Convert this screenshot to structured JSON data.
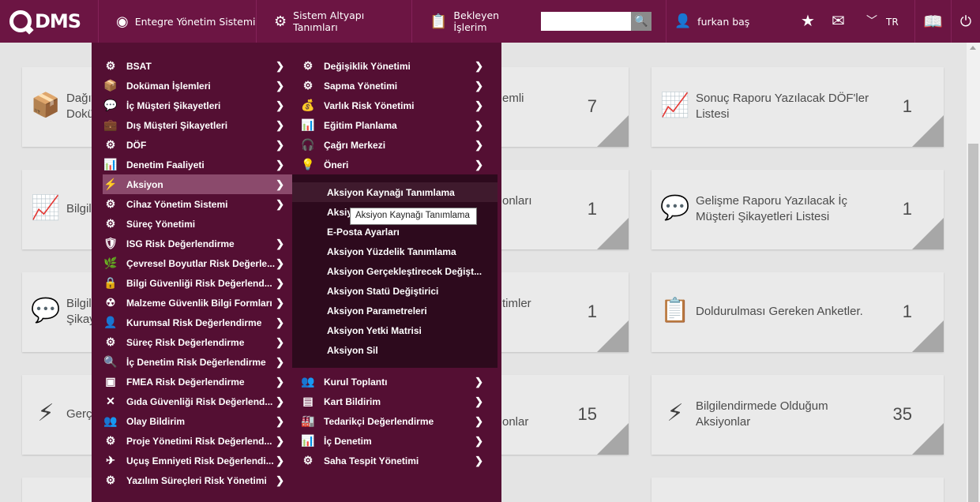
{
  "header": {
    "logo_text": "DMS",
    "nav": [
      {
        "label": "Entegre Yönetim Sistemi",
        "icon": "qdms-circle-icon"
      },
      {
        "label": "Sistem Altyapı Tanımları",
        "icon": "gear-icon"
      },
      {
        "label": "Bekleyen İşlerim",
        "icon": "clipboard-icon"
      }
    ],
    "search": {
      "value": "",
      "placeholder": ""
    },
    "user_name": "furkan baş",
    "language": "TR"
  },
  "cards": [
    {
      "text": "Dağıt\nDokü",
      "count": ""
    },
    {
      "text": "emli",
      "count": "7"
    },
    {
      "text": "Sonuç Raporu Yazılacak DÖF'ler Listesi",
      "count": "1"
    },
    {
      "text": "Bilgil",
      "count": ""
    },
    {
      "text": "onları",
      "count": "1"
    },
    {
      "text": "Gelişme Raporu Yazılacak İç Müşteri Şikayetleri Listesi",
      "count": "1"
    },
    {
      "text": "Bilgil\nŞikay",
      "count": ""
    },
    {
      "text": "timler",
      "count": "1"
    },
    {
      "text": "Doldurulması Gereken Anketler.",
      "count": "1"
    },
    {
      "text": "Gerç",
      "count": ""
    },
    {
      "text": "onlar",
      "count": "15"
    },
    {
      "text": "Bilgilendirmede Olduğum Aksiyonlar",
      "count": "35"
    }
  ],
  "menu": {
    "col1": [
      "BSAT",
      "Doküman İşlemleri",
      "İç Müşteri Şikayetleri",
      "Dış Müşteri Şikayetleri",
      "DÖF",
      "Denetim Faaliyeti",
      "Aksiyon",
      "Cihaz Yönetim Sistemi",
      "Süreç Yönetimi",
      "ISG Risk Değerlendirme",
      "Çevresel Boyutlar Risk Değerle...",
      "Bilgi Güvenliği Risk Değerlend...",
      "Malzeme Güvenlik Bilgi Formları",
      "Kurumsal Risk Değerlendirme",
      "Süreç Risk Değerlendirme",
      "İç Denetim Risk Değerlendirme",
      "FMEA Risk Değerlendirme",
      "Gıda Güvenliği Risk Değerlend...",
      "Olay Bildirim",
      "Proje Yönetimi Risk Değerlend...",
      "Uçuş Emniyeti Risk Değerlendi...",
      "Yazılım Süreçleri Risk Yönetimi"
    ],
    "col2_top": [
      "Değişiklik Yönetimi",
      "Sapma Yönetimi",
      "Varlık Risk Yönetimi",
      "Eğitim Planlama",
      "Çağrı Merkezi",
      "Öneri"
    ],
    "col2_bottom": [
      "Kurul Toplantı",
      "Kart Bildirim",
      "Tedarikçi Değerlendirme",
      "İç Denetim",
      "Saha Tespit Yönetimi"
    ],
    "arrow": "❯"
  },
  "submenu": [
    "Aksiyon Kaynağı Tanımlama",
    "Aksiy",
    "E-Posta Ayarları",
    "Aksiyon Yüzdelik Tanımlama",
    "Aksiyon Gerçekleştirecek Değişt...",
    "Aksiyon Statü Değiştirici",
    "Aksiyon Parametreleri",
    "Aksiyon Yetki Matrisi",
    "Aksiyon Sil"
  ],
  "tooltip": "Aksiyon Kaynağı Tanımlama",
  "colors": {
    "topbar": "#6c1543",
    "menu": "#540f33",
    "submenu": "#2d0a1d",
    "active": "#8b4a6c"
  }
}
